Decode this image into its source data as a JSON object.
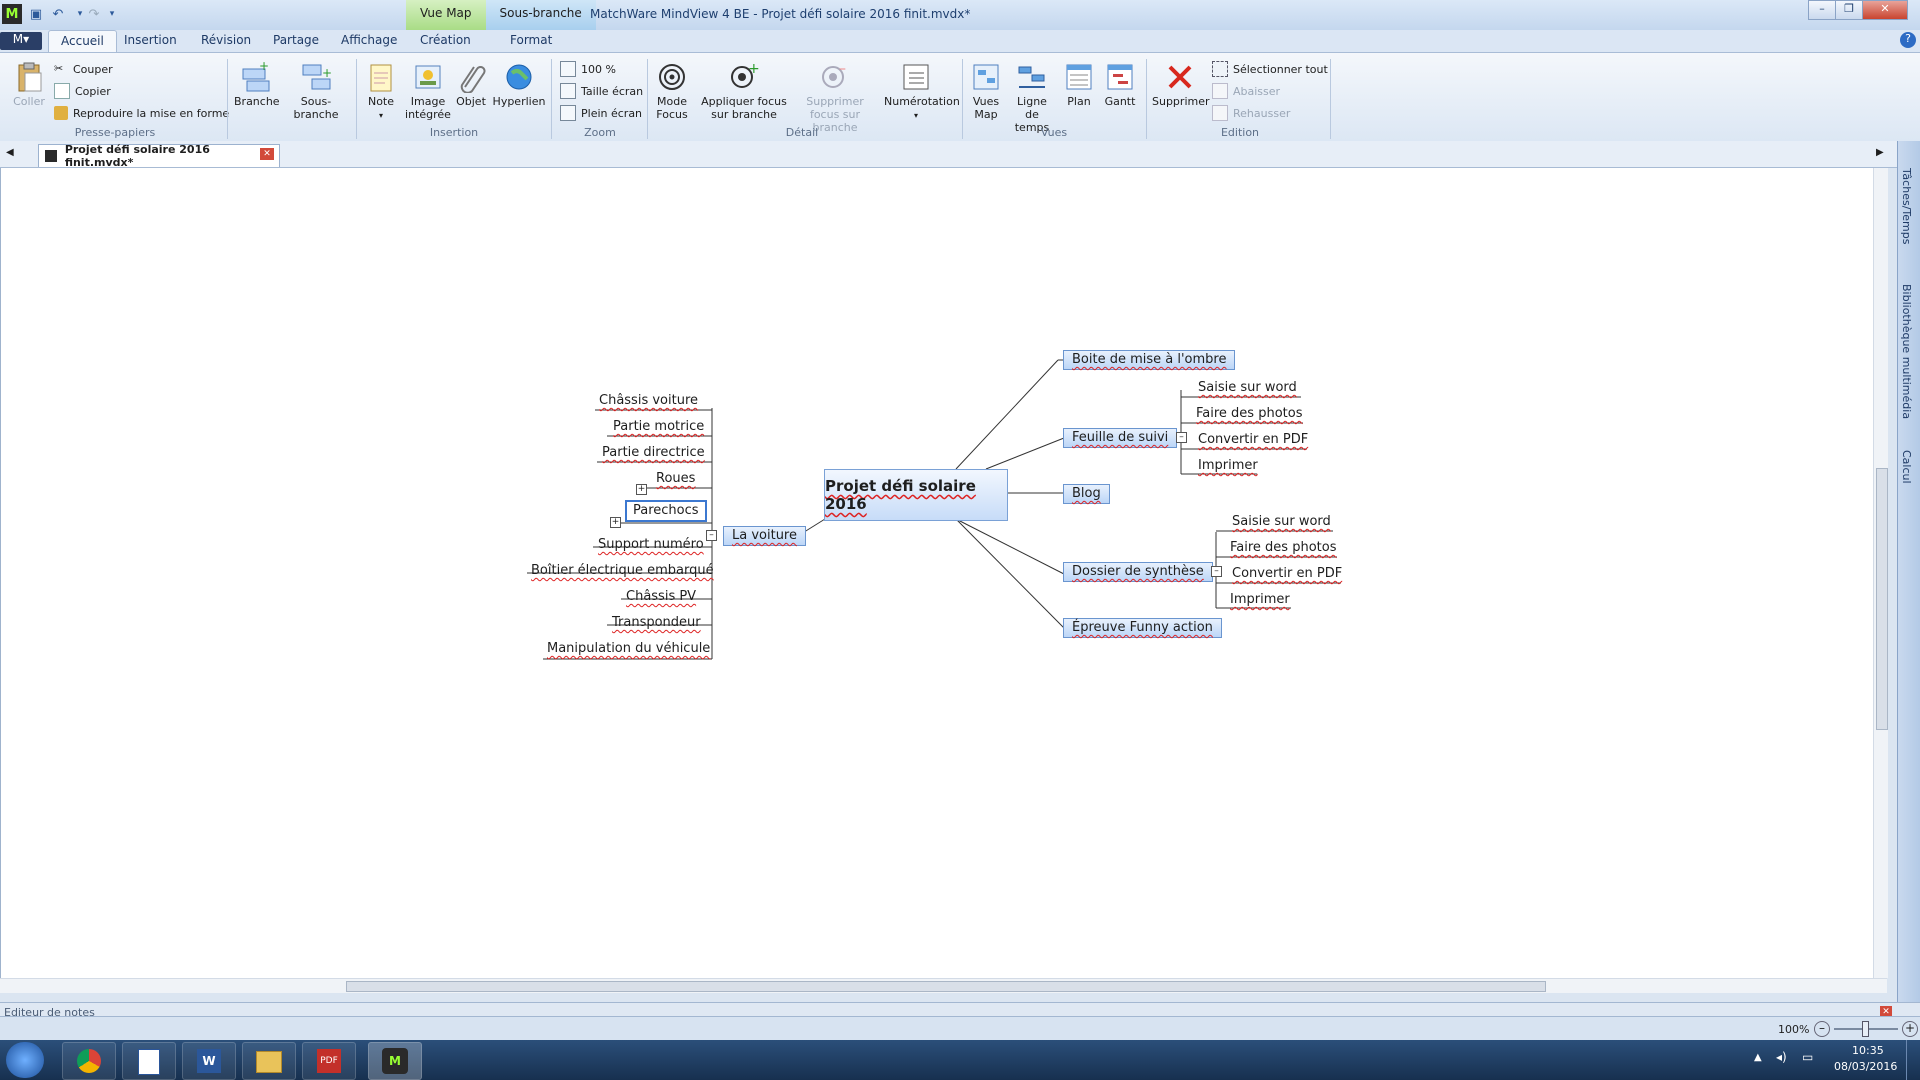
{
  "window": {
    "title": "MatchWare MindView 4 BE - Projet défi solaire 2016 finit.mvdx*",
    "context_tabs": [
      "Vue Map",
      "Sous-branche"
    ]
  },
  "ribbon_tabs": [
    "Accueil",
    "Insertion",
    "Révision",
    "Partage",
    "Affichage",
    "Création",
    "Format"
  ],
  "ribbon": {
    "clipboard": {
      "paste": "Coller",
      "cut": "Couper",
      "copy": "Copier",
      "format_painter": "Reproduire la mise en forme",
      "label": "Presse-papiers"
    },
    "insertion": {
      "branch": "Branche",
      "subbranch": "Sous-branche",
      "note": "Note",
      "image": "Image intégrée",
      "object": "Objet",
      "hyperlink": "Hyperlien",
      "label": "Insertion"
    },
    "zoom": {
      "percent": "100 %",
      "fit": "Taille écran",
      "full": "Plein écran",
      "label": "Zoom"
    },
    "detail": {
      "focus_mode": "Mode Focus",
      "apply_focus": "Appliquer focus sur branche",
      "remove_focus": "Supprimer focus sur branche",
      "numbering": "Numérotation",
      "label": "Détail"
    },
    "views": {
      "map_views": "Vues Map",
      "timeline": "Ligne de temps",
      "outline": "Plan",
      "gantt": "Gantt",
      "label": "Vues"
    },
    "edition": {
      "delete": "Supprimer",
      "select_all": "Sélectionner tout",
      "lower": "Abaisser",
      "raise": "Rehausser",
      "label": "Edition"
    }
  },
  "document_tab": "Projet défi solaire 2016 finit.mvdx*",
  "side_panel": [
    "Tâches/Temps",
    "Bibliothèque multimédia",
    "Calcul"
  ],
  "mindmap": {
    "central": "Projet défi solaire 2016",
    "right_topics": {
      "boite": "Boite de mise à l'ombre",
      "feuille": "Feuille de suivi",
      "blog": "Blog",
      "dossier": "Dossier de synthèse",
      "epreuve": "Épreuve Funny action"
    },
    "feuille_children": [
      "Saisie sur word",
      "Faire des photos",
      "Convertir en PDF",
      "Imprimer"
    ],
    "dossier_children": [
      "Saisie sur word",
      "Faire des photos",
      "Convertir en PDF",
      "Imprimer"
    ],
    "left_topic": "La voiture",
    "voiture_children": [
      "Châssis voiture",
      "Partie motrice",
      "Partie directrice",
      "Roues",
      "Parechocs",
      "Support numéro",
      "Boîtier électrique embarqué",
      "Châssis PV",
      "Transpondeur",
      "Manipulation du véhicule"
    ]
  },
  "notes_label": "Editeur de notes",
  "status": {
    "zoom": "100%"
  },
  "taskbar": {
    "time": "10:35",
    "date": "08/03/2016"
  }
}
